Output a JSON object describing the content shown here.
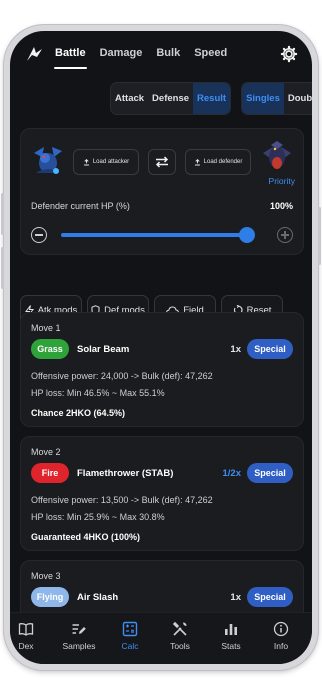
{
  "tabs": [
    {
      "label": "Battle"
    },
    {
      "label": "Damage"
    },
    {
      "label": "Bulk"
    },
    {
      "label": "Speed"
    }
  ],
  "view_toggle": {
    "attack": "Attack",
    "defense": "Defense",
    "result": "Result"
  },
  "battle_toggle": {
    "singles": "Singles",
    "doubles": "Doubles"
  },
  "pokemon": {
    "load_attacker": "Load attacker",
    "load_defender": "Load defender",
    "priority": "Priority"
  },
  "hp": {
    "label": "Defender current HP (%)",
    "value_text": "100%",
    "value": 100
  },
  "mods": {
    "atk": "Atk mods",
    "def": "Def mods",
    "field": "Field",
    "reset": "Reset"
  },
  "moves": [
    {
      "title": "Move 1",
      "type": "Grass",
      "type_color": "#2fa33a",
      "name": "Solar Beam",
      "multiplier": "1x",
      "category": "Special",
      "power_line": "Offensive power: 24,000 -> Bulk (def): 47,262",
      "hp_line": "HP loss: Min 46.5% ~ Max 55.1%",
      "ko": "Chance 2HKO (64.5%)"
    },
    {
      "title": "Move 2",
      "type": "Fire",
      "type_color": "#e0242b",
      "name": "Flamethrower (STAB)",
      "multiplier": "1/2x",
      "category": "Special",
      "power_line": "Offensive power: 13,500 -> Bulk (def): 47,262",
      "hp_line": "HP loss: Min 25.9% ~ Max 30.8%",
      "ko": "Guaranteed 4HKO (100%)"
    },
    {
      "title": "Move 3",
      "type": "Flying",
      "type_color": "#8fb7ea",
      "name": "Air Slash",
      "multiplier": "1x",
      "category": "Special"
    }
  ],
  "nav": [
    {
      "label": "Dex",
      "icon": "book-icon"
    },
    {
      "label": "Samples",
      "icon": "edit-list-icon"
    },
    {
      "label": "Calc",
      "icon": "calculator-icon"
    },
    {
      "label": "Tools",
      "icon": "tools-icon"
    },
    {
      "label": "Stats",
      "icon": "bar-chart-icon"
    },
    {
      "label": "Info",
      "icon": "info-icon"
    }
  ],
  "colors": {
    "accent": "#3f8ef2",
    "background": "#121316",
    "card": "#1b1c20",
    "special": "#2f5fc4"
  }
}
